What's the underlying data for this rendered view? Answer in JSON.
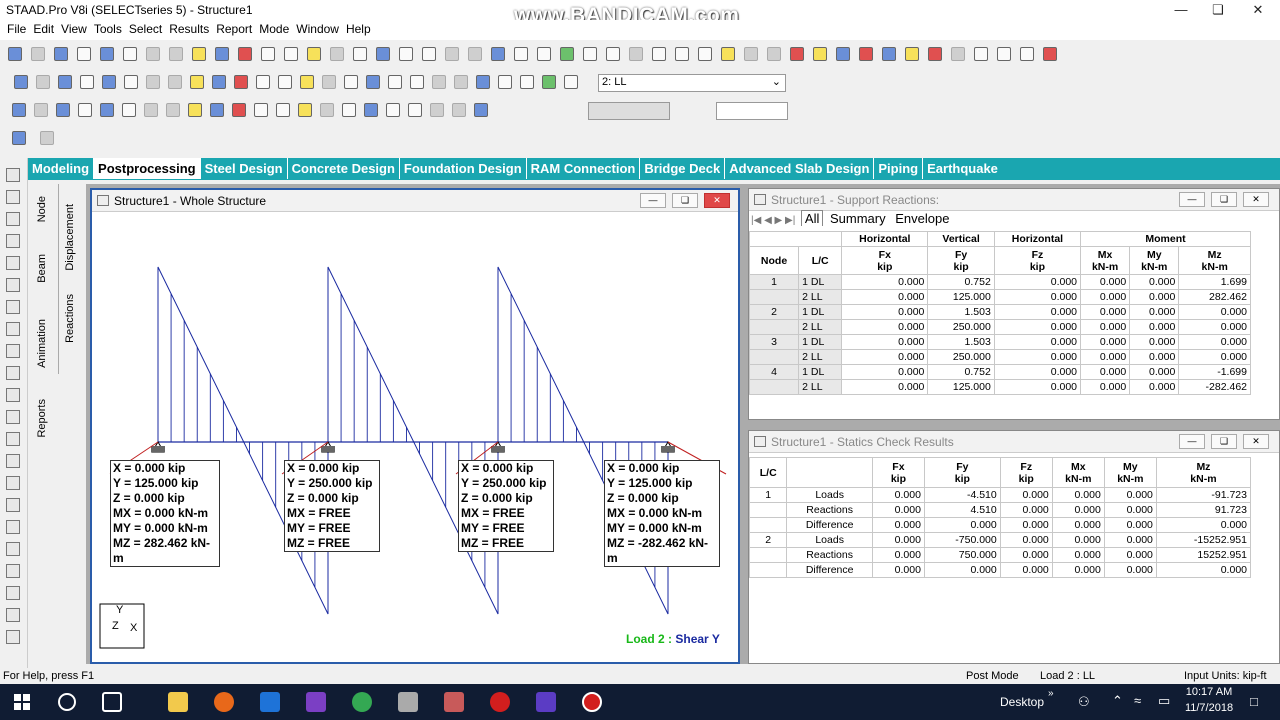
{
  "window": {
    "title": "STAAD.Pro V8i (SELECTseries 5) - Structure1",
    "watermark": "www.BANDICAM.com"
  },
  "menu": [
    "File",
    "Edit",
    "View",
    "Tools",
    "Select",
    "Results",
    "Report",
    "Mode",
    "Window",
    "Help"
  ],
  "toolbar": {
    "load_case": "2: LL"
  },
  "page_tabs": [
    "Modeling",
    "Postprocessing",
    "Steel Design",
    "Concrete Design",
    "Foundation Design",
    "RAM Connection",
    "Bridge Deck",
    "Advanced Slab Design",
    "Piping",
    "Earthquake"
  ],
  "selected_page_tab": "Postprocessing",
  "side_tabs": [
    "Node",
    "Beam",
    "Animation",
    "Reports",
    "Displacement",
    "Reactions"
  ],
  "structure_window": {
    "title": "Structure1 - Whole Structure",
    "load_label": "Load 2 :",
    "result_label": "Shear Y",
    "axis": {
      "y": "Y",
      "x": "X",
      "z": "Z"
    },
    "reaction_boxes": [
      [
        "X = 0.000 kip",
        "Y = 125.000 kip",
        "Z = 0.000 kip",
        "MX = 0.000 kN-m",
        "MY = 0.000 kN-m",
        "MZ = 282.462 kN-m"
      ],
      [
        "X = 0.000 kip",
        "Y = 250.000 kip",
        "Z = 0.000 kip",
        "MX = FREE",
        "MY = FREE",
        "MZ = FREE"
      ],
      [
        "X = 0.000 kip",
        "Y = 250.000 kip",
        "Z = 0.000 kip",
        "MX = FREE",
        "MY = FREE",
        "MZ = FREE"
      ],
      [
        "X = 0.000 kip",
        "Y = 125.000 kip",
        "Z = 0.000 kip",
        "MX = 0.000 kN-m",
        "MY = 0.000 kN-m",
        "MZ = -282.462 kN-m"
      ]
    ]
  },
  "support_reactions": {
    "title": "Structure1 - Support Reactions:",
    "tabs": [
      "All",
      "Summary",
      "Envelope"
    ],
    "group_headers": [
      "Horizontal",
      "Vertical",
      "Horizontal",
      "Moment"
    ],
    "col_headers": [
      "Node",
      "L/C",
      "Fx\nkip",
      "Fy\nkip",
      "Fz\nkip",
      "Mx\nkN-m",
      "My\nkN-m",
      "Mz\nkN-m"
    ],
    "rows": [
      [
        "1",
        "1 DL",
        "0.000",
        "0.752",
        "0.000",
        "0.000",
        "0.000",
        "1.699"
      ],
      [
        "",
        "2 LL",
        "0.000",
        "125.000",
        "0.000",
        "0.000",
        "0.000",
        "282.462"
      ],
      [
        "2",
        "1 DL",
        "0.000",
        "1.503",
        "0.000",
        "0.000",
        "0.000",
        "0.000"
      ],
      [
        "",
        "2 LL",
        "0.000",
        "250.000",
        "0.000",
        "0.000",
        "0.000",
        "0.000"
      ],
      [
        "3",
        "1 DL",
        "0.000",
        "1.503",
        "0.000",
        "0.000",
        "0.000",
        "0.000"
      ],
      [
        "",
        "2 LL",
        "0.000",
        "250.000",
        "0.000",
        "0.000",
        "0.000",
        "0.000"
      ],
      [
        "4",
        "1 DL",
        "0.000",
        "0.752",
        "0.000",
        "0.000",
        "0.000",
        "-1.699"
      ],
      [
        "",
        "2 LL",
        "0.000",
        "125.000",
        "0.000",
        "0.000",
        "0.000",
        "-282.462"
      ]
    ]
  },
  "statics_check": {
    "title": "Structure1 - Statics Check Results",
    "col_headers": [
      "L/C",
      "",
      "Fx\nkip",
      "Fy\nkip",
      "Fz\nkip",
      "Mx\nkN-m",
      "My\nkN-m",
      "Mz\nkN-m"
    ],
    "rows": [
      [
        "1",
        "Loads",
        "0.000",
        "-4.510",
        "0.000",
        "0.000",
        "0.000",
        "-91.723"
      ],
      [
        "",
        "Reactions",
        "0.000",
        "4.510",
        "0.000",
        "0.000",
        "0.000",
        "91.723"
      ],
      [
        "",
        "Difference",
        "0.000",
        "0.000",
        "0.000",
        "0.000",
        "0.000",
        "0.000"
      ],
      [
        "2",
        "Loads",
        "0.000",
        "-750.000",
        "0.000",
        "0.000",
        "0.000",
        "-15252.951"
      ],
      [
        "",
        "Reactions",
        "0.000",
        "750.000",
        "0.000",
        "0.000",
        "0.000",
        "15252.951"
      ],
      [
        "",
        "Difference",
        "0.000",
        "0.000",
        "0.000",
        "0.000",
        "0.000",
        "0.000"
      ]
    ]
  },
  "status": {
    "help": "For Help, press F1",
    "mode": "Post Mode",
    "load": "Load 2 : LL",
    "units": "Input Units:  kip-ft"
  },
  "taskbar": {
    "desktop": "Desktop",
    "time": "10:17 AM",
    "date": "11/7/2018"
  }
}
